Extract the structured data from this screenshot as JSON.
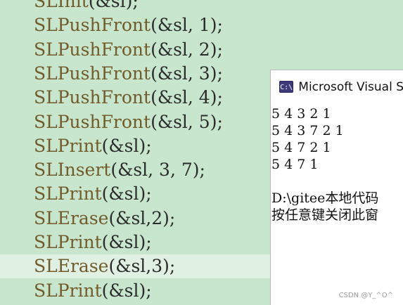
{
  "editor": {
    "lines": [
      {
        "fn": "SLInit",
        "args": "(&sl);"
      },
      {
        "fn": "SLPushFront",
        "args": "(&sl, 1);"
      },
      {
        "fn": "SLPushFront",
        "args": "(&sl, 2);"
      },
      {
        "fn": "SLPushFront",
        "args": "(&sl, 3);"
      },
      {
        "fn": "SLPushFront",
        "args": "(&sl, 4);"
      },
      {
        "fn": "SLPushFront",
        "args": "(&sl, 5);"
      },
      {
        "fn": "SLPrint",
        "args": "(&sl);"
      },
      {
        "fn": "SLInsert",
        "args": "(&sl, 3, 7);"
      },
      {
        "fn": "SLPrint",
        "args": "(&sl);"
      },
      {
        "fn": "SLErase",
        "args": "(&sl,2);"
      },
      {
        "fn": "SLPrint",
        "args": "(&sl);"
      },
      {
        "fn": "SLErase",
        "args": "(&sl,3);"
      },
      {
        "fn": "SLPrint",
        "args": "(&sl);"
      }
    ],
    "current_line_index": 11
  },
  "console": {
    "icon_label": "C:\\",
    "title": "Microsoft Visual S",
    "output": [
      "5 4 3 2 1",
      "5 4 3 7 2 1",
      "5 4 7 2 1",
      "5 4 7 1",
      "",
      "D:\\gitee本地代码",
      "按任意键关闭此窗"
    ]
  },
  "watermark": "CSDN @Y_^O^"
}
